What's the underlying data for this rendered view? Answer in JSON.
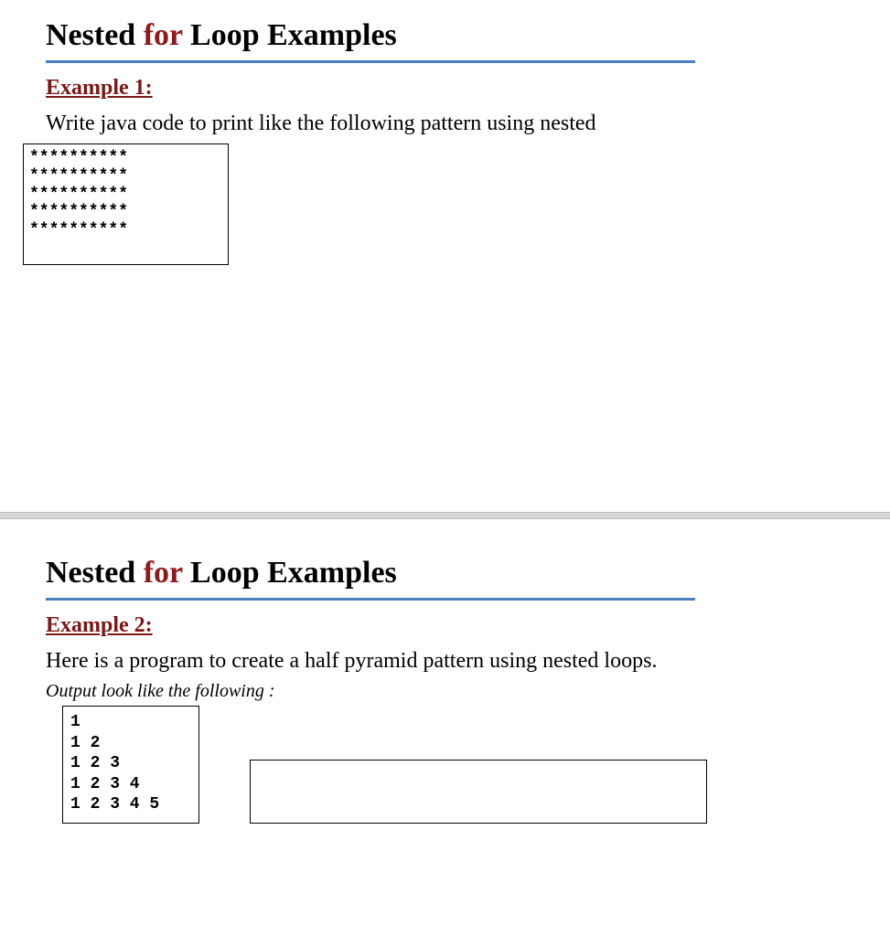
{
  "slide1": {
    "title_pre": "Nested ",
    "title_kw": "for",
    "title_post": " Loop Examples",
    "example_heading": "Example 1:",
    "body": "Write java code to print like the following pattern using nested",
    "output": "**********\n**********\n**********\n**********\n**********"
  },
  "slide2": {
    "title_pre": "Nested ",
    "title_kw": "for",
    "title_post": " Loop Examples",
    "example_heading": "Example 2:",
    "body": "Here is a program to create a half pyramid pattern using nested loops.",
    "note": "Output look like the following :",
    "output": "1\n1 2\n1 2 3\n1 2 3 4\n1 2 3 4 5"
  }
}
